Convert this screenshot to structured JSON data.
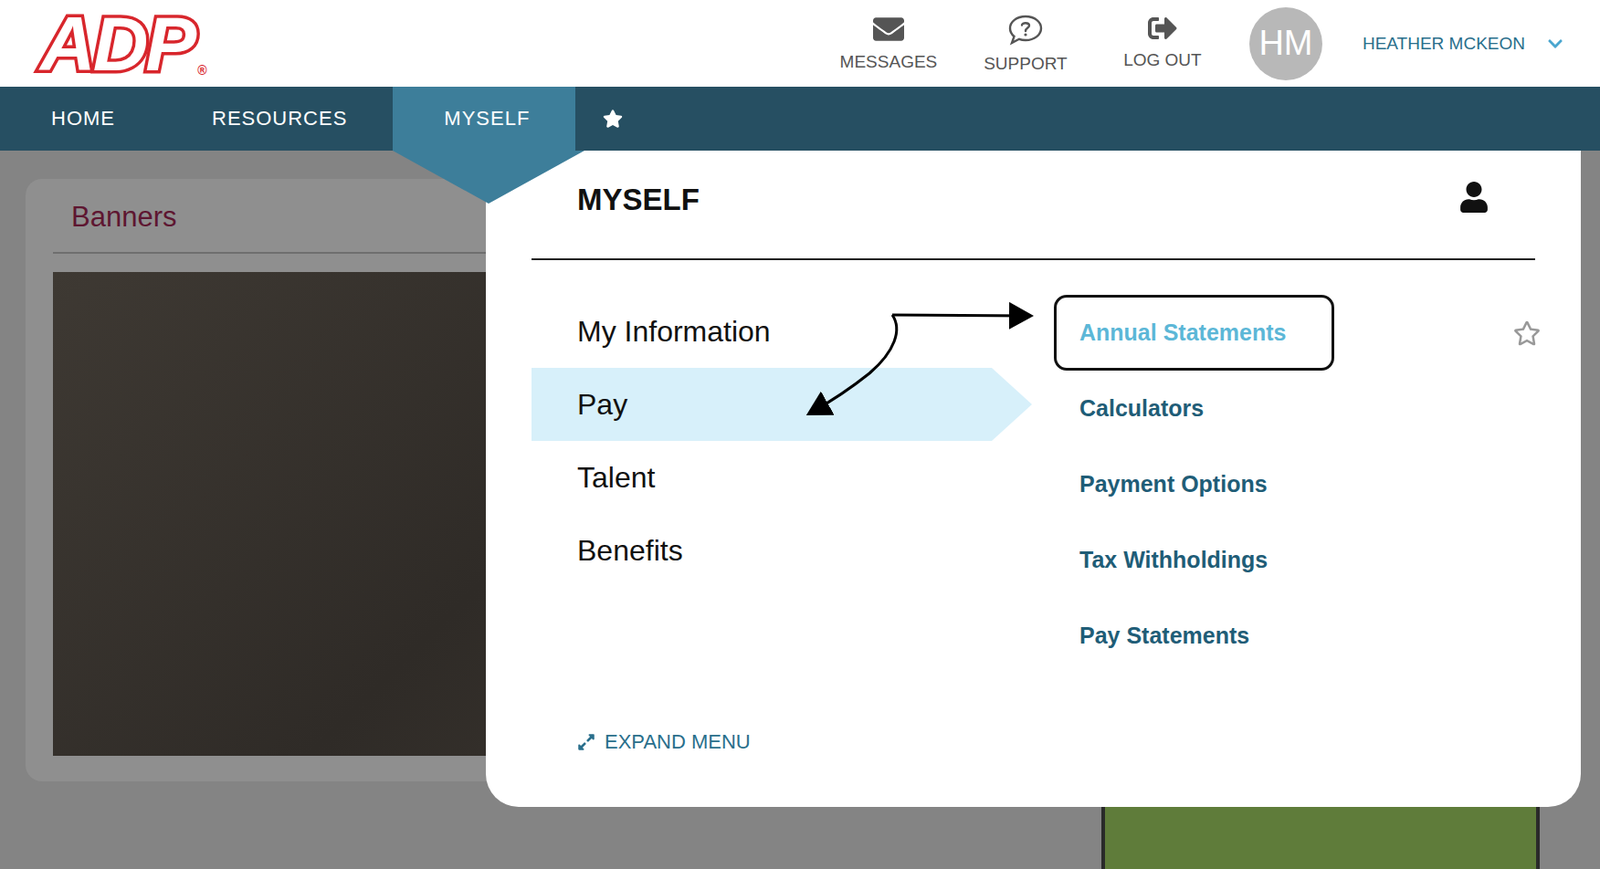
{
  "logo": {
    "text": "ADP",
    "mark": "®"
  },
  "header": {
    "actions": [
      {
        "label": "MESSAGES",
        "kind": "mail"
      },
      {
        "label": "SUPPORT",
        "kind": "support"
      },
      {
        "label": "LOG OUT",
        "kind": "logout"
      }
    ],
    "avatar": "HM",
    "user": "HEATHER MCKEON"
  },
  "nav": {
    "tabs": [
      {
        "label": "HOME",
        "selected": false
      },
      {
        "label": "RESOURCES",
        "selected": false
      },
      {
        "label": "MYSELF",
        "selected": true
      }
    ],
    "favorites_selected": false
  },
  "banner": {
    "title": "Banners"
  },
  "menu": {
    "title": "MYSELF",
    "categories": [
      {
        "label": "My Information",
        "selected": false
      },
      {
        "label": "Pay",
        "selected": true
      },
      {
        "label": "Talent",
        "selected": false
      },
      {
        "label": "Benefits",
        "selected": false
      }
    ],
    "links": [
      {
        "label": "Annual Statements",
        "highlighted": true,
        "favorite": false
      },
      {
        "label": "Calculators",
        "highlighted": false
      },
      {
        "label": "Payment Options",
        "highlighted": false
      },
      {
        "label": "Tax Withholdings",
        "highlighted": false
      },
      {
        "label": "Pay Statements",
        "highlighted": false
      }
    ],
    "expand": "EXPAND MENU"
  }
}
